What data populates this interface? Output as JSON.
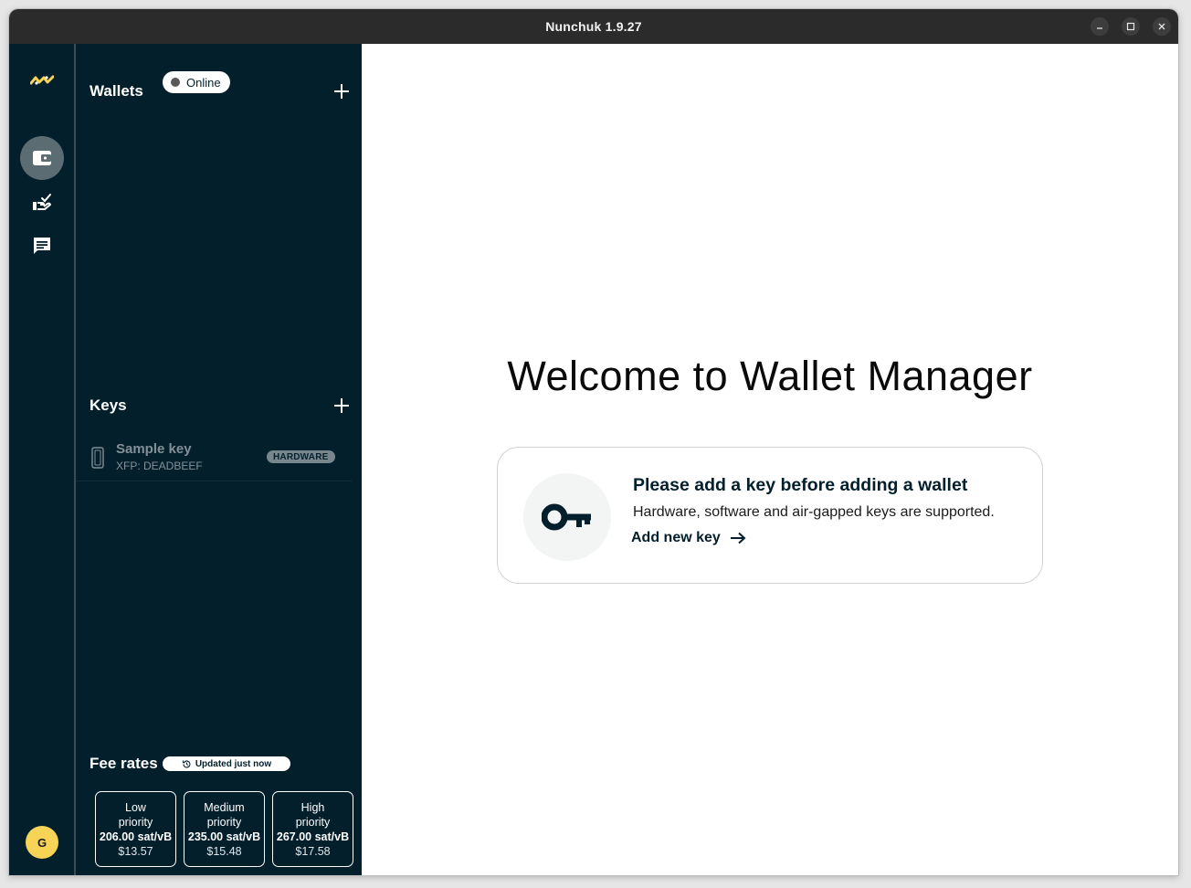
{
  "window": {
    "title": "Nunchuk 1.9.27",
    "controls": {
      "minimize": "minimize-icon",
      "maximize": "maximize-icon",
      "close": "close-icon"
    }
  },
  "rail": {
    "logo": "nunchuk-logo",
    "items": [
      {
        "name": "wallets",
        "icon": "wallet-icon",
        "active": true
      },
      {
        "name": "services",
        "icon": "hand-check-icon",
        "active": false
      },
      {
        "name": "messages",
        "icon": "chat-icon",
        "active": false
      }
    ],
    "avatar_initial": "G"
  },
  "sidebar": {
    "wallets": {
      "title": "Wallets",
      "status": "Online",
      "add_icon": "plus-icon"
    },
    "keys": {
      "title": "Keys",
      "add_icon": "plus-icon",
      "items": [
        {
          "name": "Sample key",
          "xfp": "XFP: DEADBEEF",
          "badge": "HARDWARE",
          "icon": "hardware-device-icon"
        }
      ]
    },
    "fee_rates": {
      "title": "Fee rates",
      "updated": "Updated just now",
      "cards": [
        {
          "label_line1": "Low",
          "label_line2": "priority",
          "rate": "206.00 sat/vB",
          "usd": "$13.57"
        },
        {
          "label_line1": "Medium",
          "label_line2": "priority",
          "rate": "235.00 sat/vB",
          "usd": "$15.48"
        },
        {
          "label_line1": "High",
          "label_line2": "priority",
          "rate": "267.00 sat/vB",
          "usd": "$17.58"
        }
      ]
    }
  },
  "main": {
    "welcome": "Welcome to Wallet Manager",
    "card": {
      "title": "Please add a key before adding a wallet",
      "description": "Hardware, software and air-gapped keys are supported.",
      "link": "Add new key",
      "icon": "key-icon"
    }
  },
  "colors": {
    "sidebar_bg": "#031f2b",
    "avatar": "#f8d456",
    "logo": "#f8d456"
  }
}
